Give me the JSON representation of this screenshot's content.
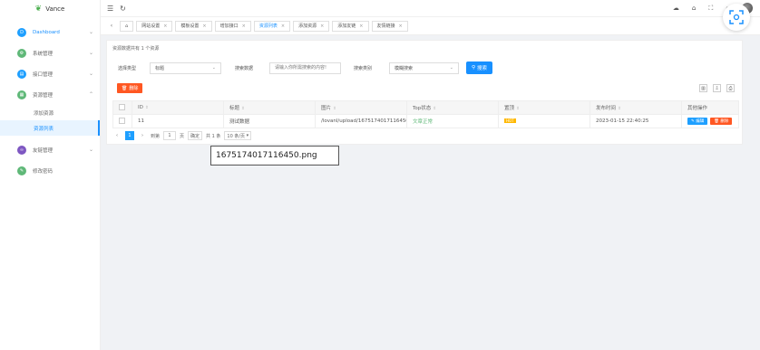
{
  "app": {
    "name": "Vance"
  },
  "sidebar": {
    "items": [
      {
        "label": "Dashboard",
        "color": "#1e9fff",
        "glyph": "D"
      },
      {
        "label": "系统管理",
        "color": "#5fb878",
        "glyph": "⚙"
      },
      {
        "label": "接口管理",
        "color": "#1e9fff",
        "glyph": "▤"
      },
      {
        "label": "资源管理",
        "color": "#5fb878",
        "glyph": "▦"
      },
      {
        "label": "友链管理",
        "color": "#7e57c2",
        "glyph": "∞"
      },
      {
        "label": "修改密码",
        "color": "#5fb878",
        "glyph": "✎"
      }
    ],
    "subitems": [
      {
        "label": "添加资源"
      },
      {
        "label": "资源列表"
      }
    ]
  },
  "tabs": [
    {
      "label": "网站设置"
    },
    {
      "label": "模板设置"
    },
    {
      "label": "增加接口"
    },
    {
      "label": "资源列表"
    },
    {
      "label": "添加资源"
    },
    {
      "label": "添加友链"
    },
    {
      "label": "友情链接"
    }
  ],
  "caption": "资源数据共有 1 个资源",
  "filters": {
    "type_label": "选择类型",
    "type_value": "标题",
    "keyword_label": "搜索数据",
    "keyword_placeholder": "请输入你所需搜索的内容!",
    "mode_label": "搜索类别",
    "mode_value": "模糊搜索",
    "search_label": "搜索"
  },
  "toolbar": {
    "delete_label": "删除"
  },
  "table": {
    "columns": [
      "ID",
      "标题",
      "图片",
      "Top状态",
      "置顶",
      "发布时间",
      "其他操作"
    ],
    "rows": [
      {
        "id": "11",
        "title": "测试数据",
        "image": "/lovanl/upload/1675174017116450...",
        "top": "文章正常",
        "hot": "HOT",
        "time": "2023-01-15 22:40:25",
        "edit": "编辑",
        "del": "删除"
      }
    ]
  },
  "pager": {
    "page": "1",
    "goto_label": "到第",
    "goto_value": "1",
    "page_unit": "页",
    "confirm": "确定",
    "total": "共 1 条",
    "per_page": "10 条/页"
  },
  "tooltip": {
    "text": "1675174017116450.png"
  }
}
